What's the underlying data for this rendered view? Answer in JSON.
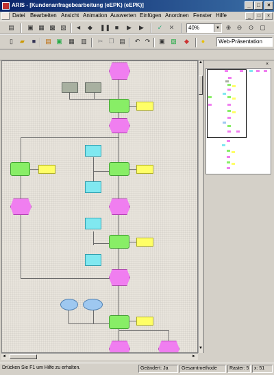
{
  "window": {
    "title": "ARIS - [Kundenanfragebearbeitung (eEPK) (eEPK)]",
    "controls": [
      "_",
      "□",
      "×"
    ]
  },
  "menubar": {
    "items": [
      "Datei",
      "Bearbeiten",
      "Ansicht",
      "Animation",
      "Auswerten",
      "Einfügen",
      "Anordnen",
      "Fenster",
      "Hilfe"
    ],
    "doc_controls": [
      "_",
      "□",
      "×"
    ]
  },
  "toolbar": {
    "zoom_value": "40%",
    "web_label": "Web-Präsentation"
  },
  "overview": {
    "close": "×"
  },
  "statusbar": {
    "help": "Drücken Sie F1 um Hilfe zu erhalten.",
    "changed": "Geändert: Ja",
    "method": "Gesamtmethode",
    "grid": "Raster: 5",
    "coord": "x: 51"
  },
  "colors": {
    "event": "#f07ef0",
    "function": "#88ee66",
    "org_unit": "#ffff66",
    "info_object": "#80e8f0",
    "system": "#a8b0a0",
    "title_bar": "#0a246a"
  }
}
